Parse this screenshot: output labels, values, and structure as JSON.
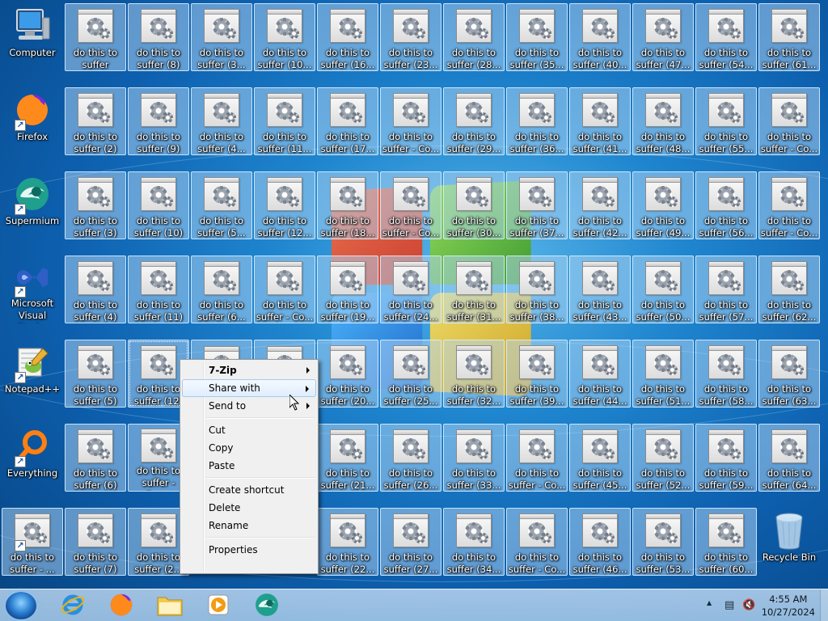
{
  "desktop": {
    "shortcuts": [
      {
        "label": "Computer",
        "icon": "computer-icon"
      },
      {
        "label": "Firefox",
        "icon": "firefox-icon"
      },
      {
        "label": "Supermium",
        "icon": "supermium-icon"
      },
      {
        "label": "Microsoft Visual Stud...",
        "icon": "visual-studio-icon"
      },
      {
        "label": "Notepad++",
        "icon": "notepad-plus-plus-icon"
      },
      {
        "label": "Everything",
        "icon": "everything-search-icon"
      },
      {
        "label": "do this to suffer - ...",
        "icon": "program-file-icon"
      }
    ],
    "files": [
      [
        "do this to suffer",
        "do this to suffer (8)",
        "do this to suffer (3...",
        "do this to suffer (10...",
        "do this to suffer (16...",
        "do this to suffer (23...",
        "do this to suffer (28...",
        "do this to suffer (35...",
        "do this to suffer (40...",
        "do this to suffer (47...",
        "do this to suffer (54...",
        "do this to suffer (61..."
      ],
      [
        "do this to suffer (2)",
        "do this to suffer (9)",
        "do this to suffer (4...",
        "do this to suffer (11...",
        "do this to suffer (17...",
        "do this to suffer - Co...",
        "do this to suffer (29...",
        "do this to suffer (36...",
        "do this to suffer (41...",
        "do this to suffer (48...",
        "do this to suffer (55...",
        "do this to suffer - Co..."
      ],
      [
        "do this to suffer (3)",
        "do this to suffer (10)",
        "do this to suffer (5...",
        "do this to suffer (12...",
        "do this to suffer (18...",
        "do this to suffer - Co...",
        "do this to suffer (30...",
        "do this to suffer (37...",
        "do this to suffer (42...",
        "do this to suffer (49...",
        "do this to suffer (56...",
        "do this to suffer - Co..."
      ],
      [
        "do this to suffer (4)",
        "do this to suffer (11)",
        "do this to suffer (6...",
        "do this to suffer - Co...",
        "do this to suffer (19...",
        "do this to suffer (24...",
        "do this to suffer (31...",
        "do this to suffer (38...",
        "do this to suffer (43...",
        "do this to suffer (50...",
        "do this to suffer (57...",
        "do this to suffer (62..."
      ],
      [
        "do this to suffer (5)",
        "do this to suffer (12)",
        "",
        "",
        "do this to suffer (20...",
        "do this to suffer (25...",
        "do this to suffer (32...",
        "do this to suffer (39...",
        "do this to suffer (44...",
        "do this to suffer (51...",
        "do this to suffer (58...",
        "do this to suffer (63..."
      ],
      [
        "do this to suffer (6)",
        "do this to suffer - Cop...",
        "",
        "",
        "do this to suffer (21...",
        "do this to suffer (26...",
        "do this to suffer (33...",
        "do this to suffer - Co...",
        "do this to suffer (45...",
        "do this to suffer (52...",
        "do this to suffer (59...",
        "do this to suffer (64..."
      ],
      [
        "do this to suffer (7)",
        "do this to suffer (2...",
        "",
        "",
        "do this to suffer (22...",
        "do this to suffer (27...",
        "do this to suffer (34...",
        "do this to suffer - Co...",
        "do this to suffer (46...",
        "do this to suffer (53...",
        "do this to suffer (60..."
      ]
    ],
    "recycle_bin": {
      "label": "Recycle Bin",
      "icon": "recycle-bin-icon"
    }
  },
  "context_menu": {
    "items": [
      {
        "label": "7-Zip",
        "bold": true,
        "submenu": true
      },
      {
        "label": "Share with",
        "submenu": true,
        "hovered": true
      },
      {
        "label": "Send to",
        "submenu": true
      },
      {
        "separator": true
      },
      {
        "label": "Cut"
      },
      {
        "label": "Copy"
      },
      {
        "label": "Paste"
      },
      {
        "separator": true
      },
      {
        "label": "Create shortcut"
      },
      {
        "label": "Delete"
      },
      {
        "label": "Rename"
      },
      {
        "separator": true
      },
      {
        "label": "Properties"
      }
    ]
  },
  "taskbar": {
    "start_icon": "windows-start-icon",
    "pinned": [
      {
        "name": "internet-explorer",
        "icon": "internet-explorer-icon",
        "color": "#2a8fe0"
      },
      {
        "name": "firefox",
        "icon": "firefox-icon",
        "color": "#ff7a1a"
      },
      {
        "name": "explorer",
        "icon": "folder-icon",
        "color": "#f2c94c"
      },
      {
        "name": "media-player",
        "icon": "media-player-icon",
        "color": "#f39c12"
      },
      {
        "name": "supermium",
        "icon": "supermium-icon",
        "color": "#2bb5a0"
      }
    ],
    "tray": {
      "icons": [
        "show-hidden-icons-icon",
        "network-icon",
        "volume-muted-icon"
      ],
      "time": "4:55 AM",
      "date": "10/27/2024"
    }
  },
  "colors": {
    "menu_bg": "#f0f0f0",
    "selection": "#b4d7f5",
    "desktop_blue": "#0d5fae"
  }
}
